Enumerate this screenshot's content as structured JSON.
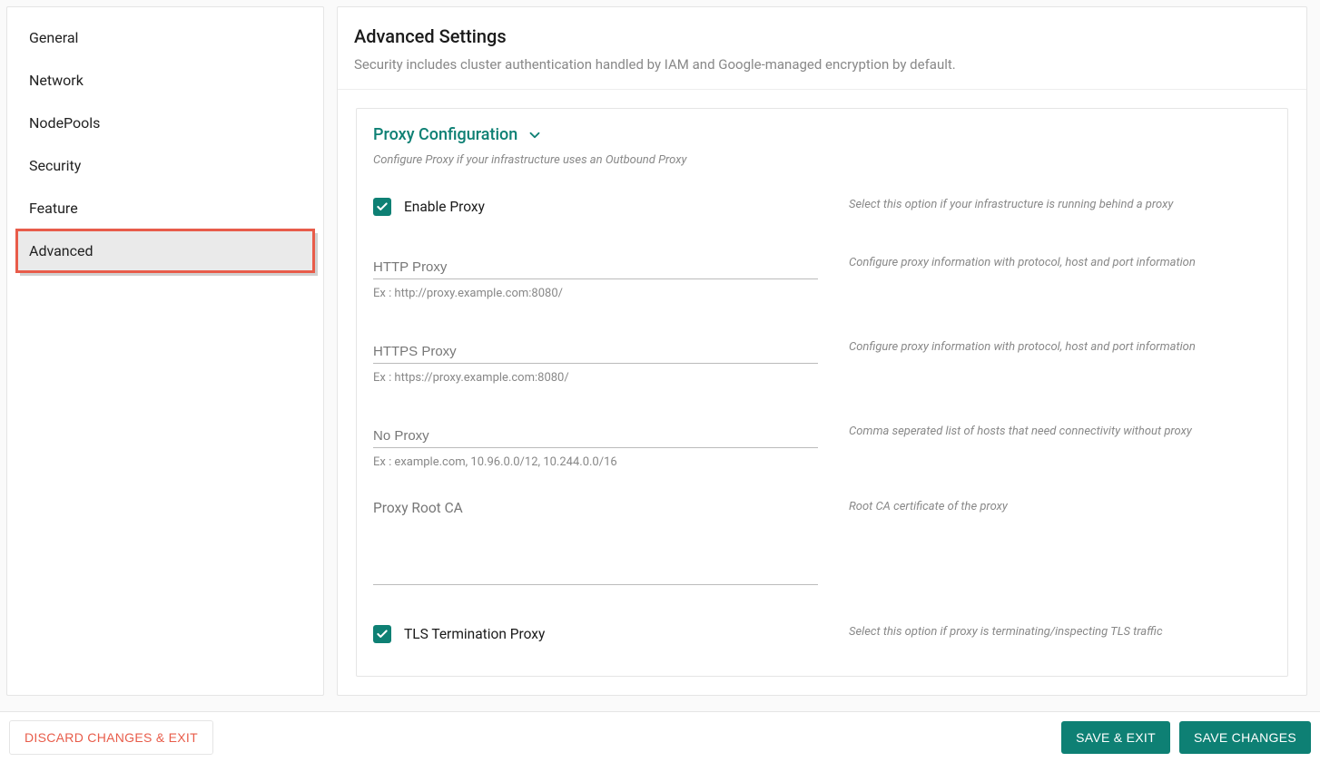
{
  "sidebar": {
    "items": [
      {
        "label": "General"
      },
      {
        "label": "Network"
      },
      {
        "label": "NodePools"
      },
      {
        "label": "Security"
      },
      {
        "label": "Feature"
      },
      {
        "label": "Advanced"
      }
    ]
  },
  "header": {
    "title": "Advanced Settings",
    "subtitle": "Security includes cluster authentication handled by IAM and Google-managed encryption by default."
  },
  "card": {
    "title": "Proxy Configuration",
    "subtitle": "Configure Proxy if your infrastructure uses an Outbound Proxy",
    "enable_proxy": {
      "label": "Enable Proxy",
      "hint": "Select this option if your infrastructure is running behind a proxy",
      "checked": true
    },
    "http_proxy": {
      "placeholder": "HTTP Proxy",
      "hint_below": "Ex : http://proxy.example.com:8080/",
      "hint_right": "Configure proxy information with protocol, host and port information"
    },
    "https_proxy": {
      "placeholder": "HTTPS Proxy",
      "hint_below": "Ex : https://proxy.example.com:8080/",
      "hint_right": "Configure proxy information with protocol, host and port information"
    },
    "no_proxy": {
      "placeholder": "No Proxy",
      "hint_below": "Ex : example.com, 10.96.0.0/12, 10.244.0.0/16",
      "hint_right": "Comma seperated list of hosts that need connectivity without proxy"
    },
    "root_ca": {
      "label": "Proxy Root CA",
      "hint_right": "Root CA certificate of the proxy"
    },
    "tls_term": {
      "label": "TLS Termination Proxy",
      "hint": "Select this option if proxy is terminating/inspecting TLS traffic",
      "checked": true
    }
  },
  "footer": {
    "discard": "DISCARD CHANGES & EXIT",
    "save_exit": "SAVE & EXIT",
    "save": "SAVE CHANGES"
  }
}
